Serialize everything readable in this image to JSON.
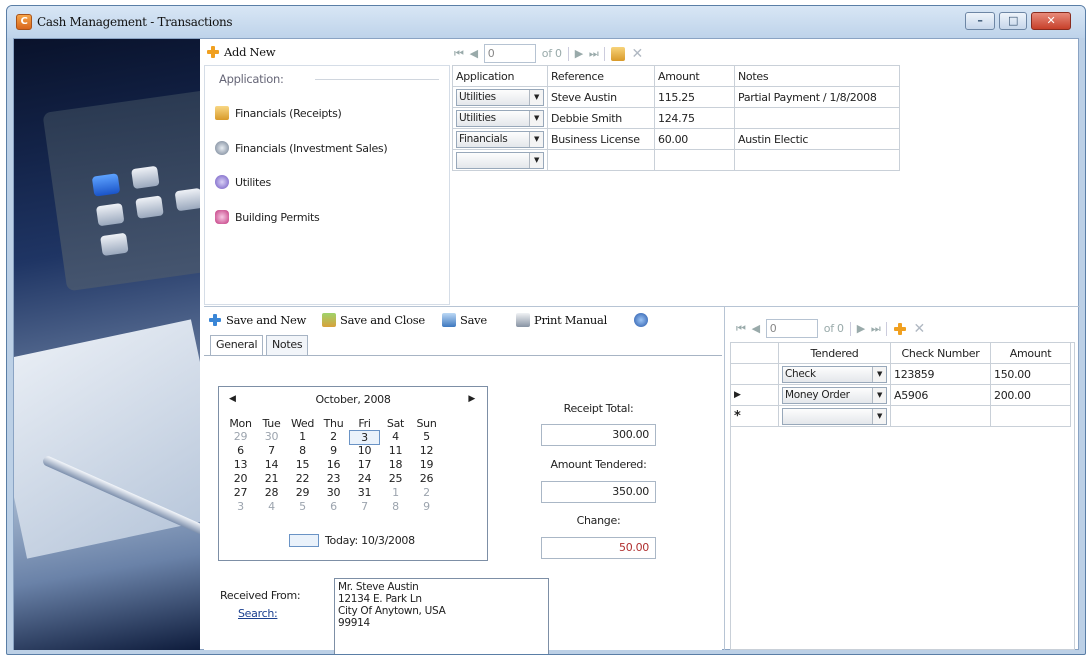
{
  "window": {
    "title": "Cash Management - Transactions"
  },
  "top_toolbar": {
    "add_new": "Add New",
    "nav_position": "0",
    "nav_of": "of 0"
  },
  "application_panel": {
    "header": "Application:",
    "items": [
      {
        "label": "Financials (Receipts)",
        "icon": "folder-icon"
      },
      {
        "label": "Financials (Investment Sales)",
        "icon": "disc-icon"
      },
      {
        "label": "Utilites",
        "icon": "utility-icon"
      },
      {
        "label": "Building Permits",
        "icon": "permit-icon"
      }
    ]
  },
  "top_grid": {
    "columns": [
      "Application",
      "Reference",
      "Amount",
      "Notes"
    ],
    "rows": [
      {
        "application": "Utilities",
        "reference": "Steve Austin",
        "amount": "115.25",
        "notes": "Partial Payment / 1/8/2008"
      },
      {
        "application": "Utilities",
        "reference": "Debbie Smith",
        "amount": "124.75",
        "notes": ""
      },
      {
        "application": "Financials",
        "reference": "Business License",
        "amount": "60.00",
        "notes": "Austin Electic"
      },
      {
        "application": "",
        "reference": "",
        "amount": "",
        "notes": ""
      }
    ]
  },
  "action_toolbar": {
    "save_and_new": "Save and New",
    "save_and_close": "Save and Close",
    "save": "Save",
    "print_manual": "Print Manual"
  },
  "tabs": {
    "general": "General",
    "notes": "Notes"
  },
  "calendar": {
    "month": "October, 2008",
    "days": [
      "Mon",
      "Tue",
      "Wed",
      "Thu",
      "Fri",
      "Sat",
      "Sun"
    ],
    "weeks": [
      [
        "29",
        "30",
        "1",
        "2",
        "3",
        "4",
        "5"
      ],
      [
        "6",
        "7",
        "8",
        "9",
        "10",
        "11",
        "12"
      ],
      [
        "13",
        "14",
        "15",
        "16",
        "17",
        "18",
        "19"
      ],
      [
        "20",
        "21",
        "22",
        "23",
        "24",
        "25",
        "26"
      ],
      [
        "27",
        "28",
        "29",
        "30",
        "31",
        "1",
        "2"
      ],
      [
        "3",
        "4",
        "5",
        "6",
        "7",
        "8",
        "9"
      ]
    ],
    "today": "Today: 10/3/2008"
  },
  "receipt": {
    "receipt_total_label": "Receipt Total:",
    "receipt_total": "300.00",
    "amount_tendered_label": "Amount Tendered:",
    "amount_tendered": "350.00",
    "change_label": "Change:",
    "change": "50.00",
    "change_color": "#b03030"
  },
  "received_from": {
    "label": "Received From:",
    "search": "Search:",
    "address_lines": [
      "Mr. Steve Austin",
      "12134 E. Park Ln",
      "City Of Anytown, USA",
      "99914"
    ]
  },
  "right_toolbar": {
    "nav_position": "0",
    "nav_of": "of 0"
  },
  "tender_grid": {
    "columns": [
      "Tendered",
      "Check Number",
      "Amount"
    ],
    "rows": [
      {
        "tendered": "Check",
        "check_number": "123859",
        "amount": "150.00"
      },
      {
        "tendered": "Money Order",
        "check_number": "A5906",
        "amount": "200.00"
      },
      {
        "tendered": "",
        "check_number": "",
        "amount": ""
      }
    ],
    "new_row_marker": "*"
  }
}
